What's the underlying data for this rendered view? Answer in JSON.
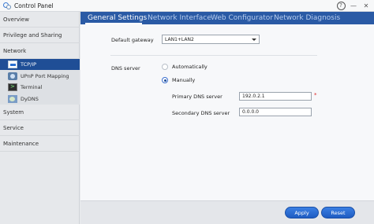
{
  "window": {
    "title": "Control Panel"
  },
  "sidebar": {
    "items": [
      {
        "label": "Overview"
      },
      {
        "label": "Privilege and Sharing"
      },
      {
        "label": "Network"
      },
      {
        "label": "System"
      },
      {
        "label": "Service"
      },
      {
        "label": "Maintenance"
      }
    ],
    "network_subitems": [
      {
        "label": "TCP/IP",
        "icon": "tcpip-icon",
        "active": true
      },
      {
        "label": "UPnP Port Mapping",
        "icon": "upnp-icon",
        "active": false
      },
      {
        "label": "Terminal",
        "icon": "terminal-icon",
        "active": false
      },
      {
        "label": "DyDNS",
        "icon": "dydns-icon",
        "active": false
      }
    ]
  },
  "tabs": [
    {
      "label": "General Settings",
      "active": true
    },
    {
      "label": "Network Interface",
      "active": false
    },
    {
      "label": "Web Configurator",
      "active": false
    },
    {
      "label": "Network Diagnosis",
      "active": false
    }
  ],
  "form": {
    "default_gateway_label": "Default gateway",
    "default_gateway_value": "LAN1+LAN2",
    "dns_server_label": "DNS server",
    "dns_mode_options": [
      {
        "label": "Automatically",
        "selected": false
      },
      {
        "label": "Manually",
        "selected": true
      }
    ],
    "primary_dns_label": "Primary DNS server",
    "primary_dns_value": "192.0.2.1",
    "primary_dns_required_marker": "*",
    "secondary_dns_label": "Secondary DNS server",
    "secondary_dns_value": "0.0.0.0"
  },
  "footer": {
    "apply_label": "Apply",
    "reset_label": "Reset"
  },
  "colors": {
    "accent": "#1f4e96",
    "tab_bar": "#2a5aa5",
    "button": "#2a6cd6"
  }
}
